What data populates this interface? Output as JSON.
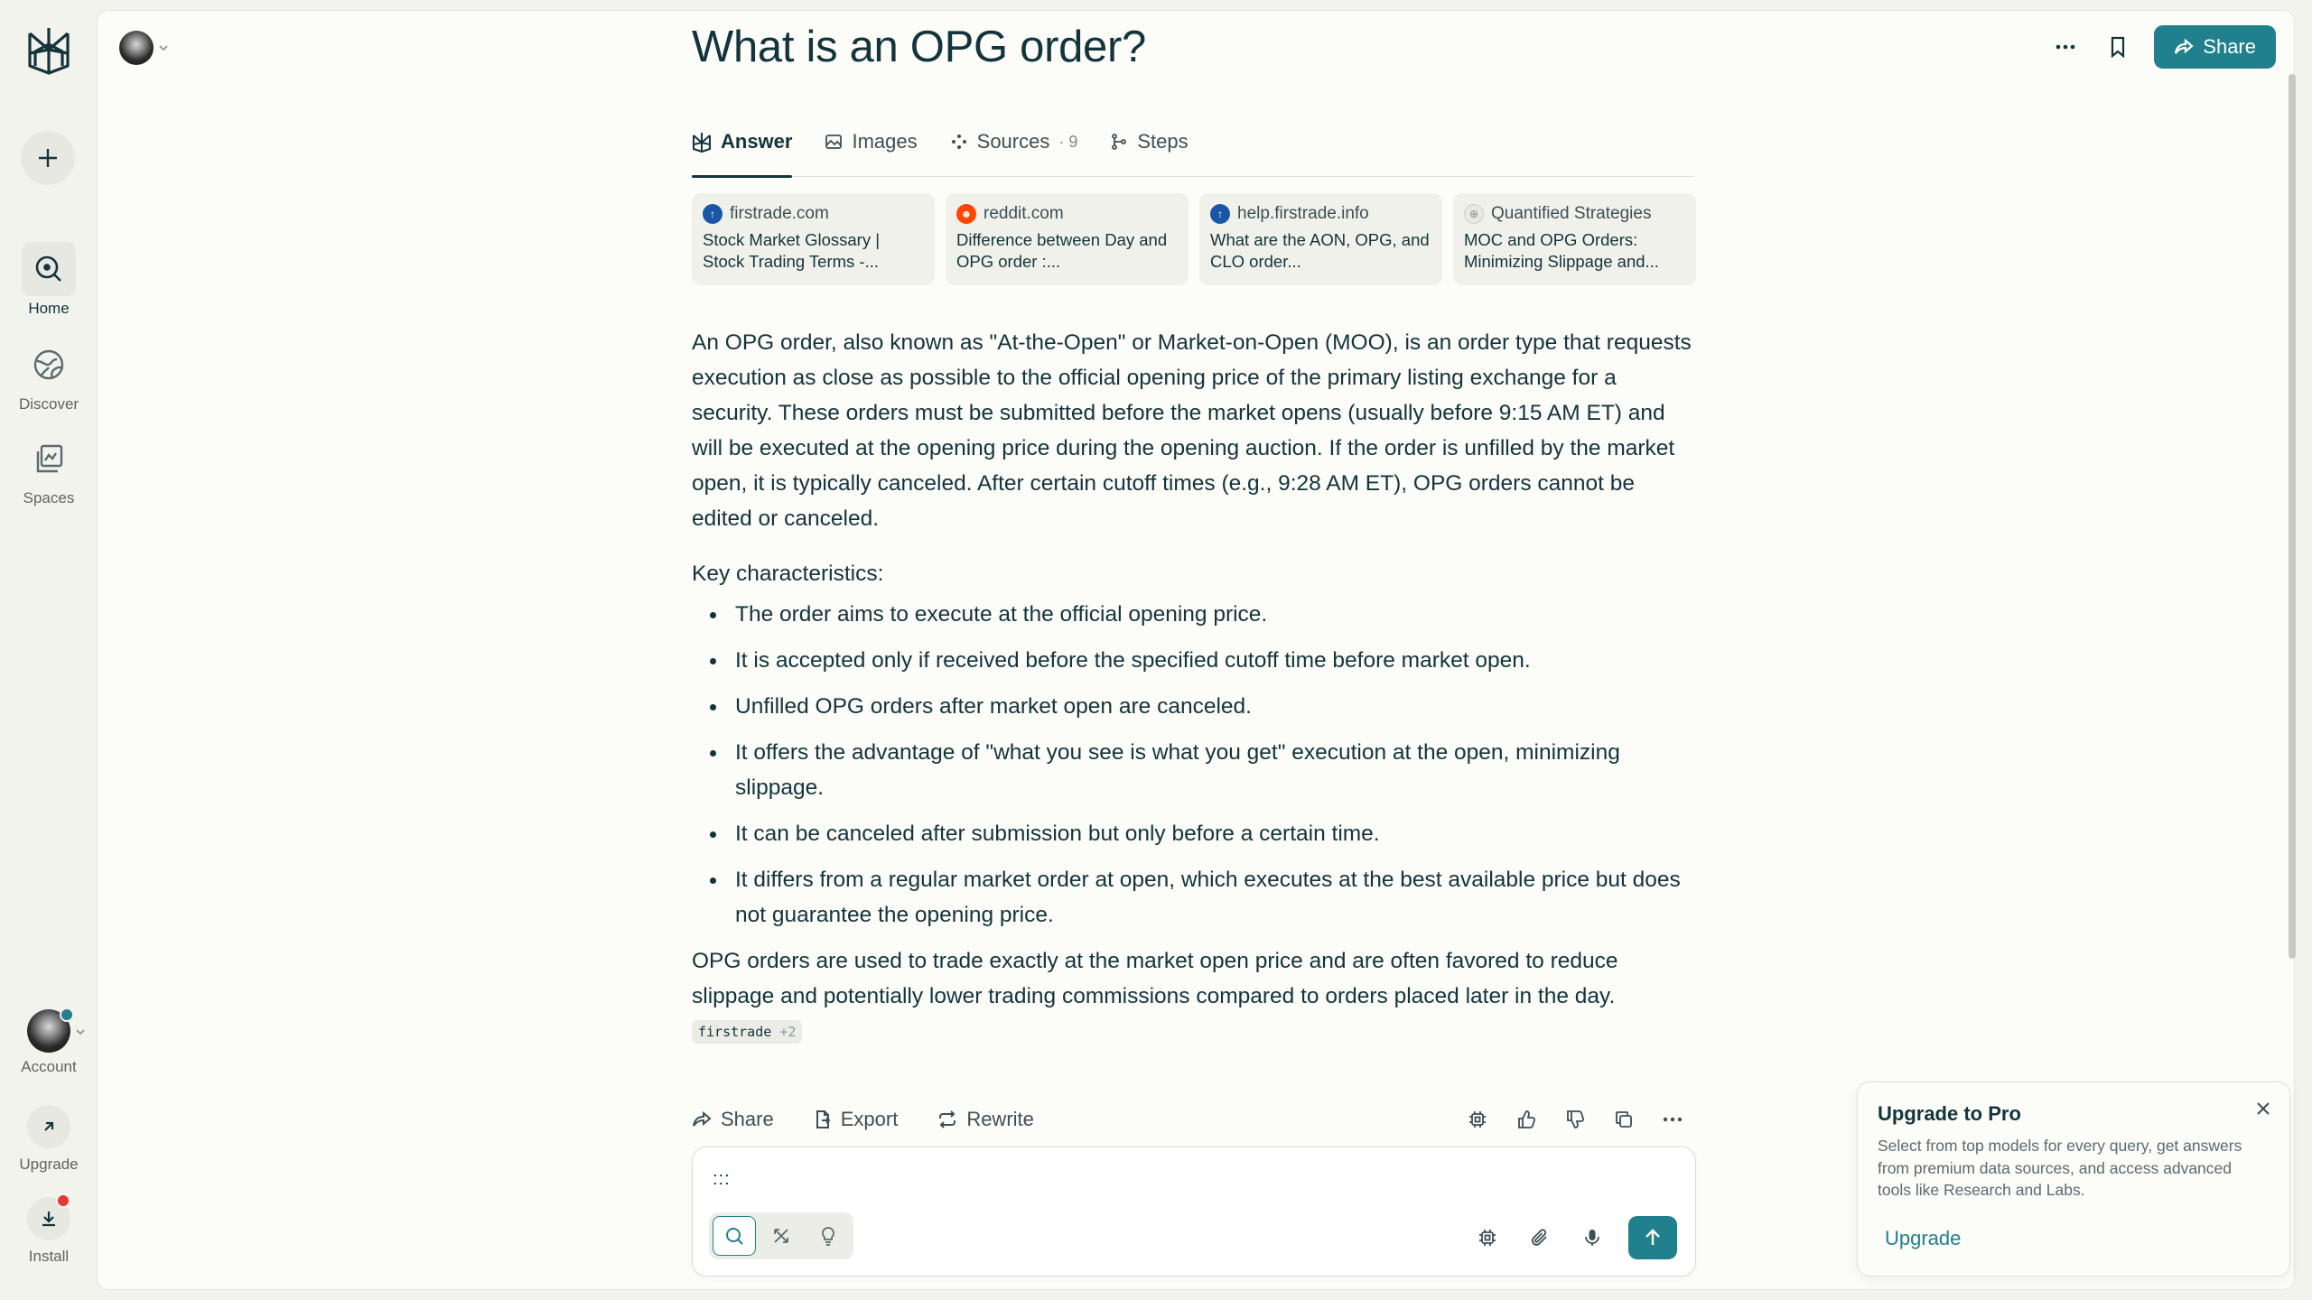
{
  "sidebar": {
    "nav": [
      {
        "label": "Home",
        "icon": "search-circle-icon",
        "active": true
      },
      {
        "label": "Discover",
        "icon": "globe-icon",
        "active": false
      },
      {
        "label": "Spaces",
        "icon": "spaces-icon",
        "active": false
      }
    ],
    "bottom": [
      {
        "label": "Account",
        "icon": "avatar"
      },
      {
        "label": "Upgrade",
        "icon": "arrow-up-right-icon"
      },
      {
        "label": "Install",
        "icon": "download-icon"
      }
    ]
  },
  "thread": {
    "title": "What is an OPG order?",
    "share_label": "Share"
  },
  "tabs": [
    {
      "label": "Answer",
      "active": true
    },
    {
      "label": "Images",
      "active": false
    },
    {
      "label": "Sources",
      "count": "· 9",
      "active": false
    },
    {
      "label": "Steps",
      "active": false
    }
  ],
  "sources": [
    {
      "domain": "firstrade.com",
      "title": "Stock Market Glossary | Stock Trading Terms -...",
      "color": "#1a56a8"
    },
    {
      "domain": "reddit.com",
      "title": "Difference between Day and OPG order :...",
      "color": "#ff4500"
    },
    {
      "domain": "help.firstrade.info",
      "title": "What are the AON, OPG, and CLO order...",
      "color": "#1a56a8"
    },
    {
      "domain": "Quantified Strategies",
      "title": "MOC and OPG Orders: Minimizing Slippage and...",
      "color": "#bdbdb5"
    }
  ],
  "answer": {
    "intro": "An OPG order, also known as \"At-the-Open\" or Market-on-Open (MOO), is an order type that requests execution as close as possible to the official opening price of the primary listing exchange for a security. These orders must be submitted before the market opens (usually before 9:15 AM ET) and will be executed at the opening price during the opening auction. If the order is unfilled by the market open, it is typically canceled. After certain cutoff times (e.g., 9:28 AM ET), OPG orders cannot be edited or canceled.",
    "key_heading": "Key characteristics:",
    "bullets": [
      "The order aims to execute at the official opening price.",
      "It is accepted only if received before the specified cutoff time before market open.",
      "Unfilled OPG orders after market open are canceled.",
      "It offers the advantage of \"what you see is what you get\" execution at the open, minimizing slippage.",
      "It can be canceled after submission but only before a certain time.",
      "It differs from a regular market order at open, which executes at the best available price but does not guarantee the opening price."
    ],
    "conclusion": "OPG orders are used to trade exactly at the market open price and are often favored to reduce slippage and potentially lower trading commissions compared to orders placed later in the day.",
    "citation": {
      "source": "firstrade",
      "more": "+2"
    }
  },
  "answer_actions": {
    "share": "Share",
    "export": "Export",
    "rewrite": "Rewrite"
  },
  "composer": {
    "placeholder": ":::"
  },
  "promo": {
    "title": "Upgrade to Pro",
    "body": "Select from top models for every query, get answers from premium data sources, and access advanced tools like Research and Labs.",
    "cta": "Upgrade"
  },
  "colors": {
    "accent": "#21808d",
    "text": "#13343b",
    "background": "#fcfcf9",
    "notification": "#e53935",
    "online": "#21808d"
  }
}
